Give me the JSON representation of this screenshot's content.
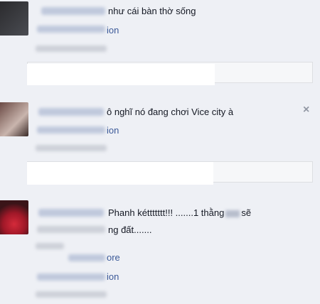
{
  "comments": [
    {
      "text": "như cái bàn thờ sống",
      "translation_link": "ion"
    },
    {
      "text": "ô nghĩ nó đang chơi Vice city à",
      "translation_link": "ion",
      "close_glyph": "×"
    },
    {
      "text_part1": "Phanh kéttttttt!!! .......1 thằng",
      "text_part2": "sẽ",
      "text_line2": "ng đất.......",
      "more_link": "ore",
      "translation_link": "ion"
    }
  ]
}
